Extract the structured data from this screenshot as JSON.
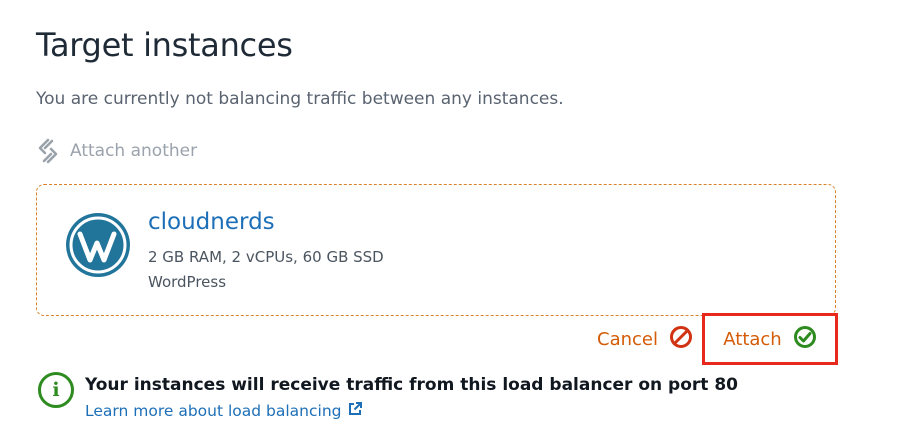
{
  "page": {
    "title": "Target instances",
    "subtitle": "You are currently not balancing traffic between any instances."
  },
  "attach_another": {
    "label": "Attach another",
    "icon": "attach-chain-icon",
    "disabled": true
  },
  "instance_card": {
    "name": "cloudnerds",
    "specs": "2 GB RAM, 2 vCPUs, 60 GB SSD",
    "blueprint": "WordPress",
    "logo_icon": "wordpress-logo-icon",
    "border_color": "#d9822b"
  },
  "actions": {
    "cancel_label": "Cancel",
    "cancel_icon": "cancel-slash-icon",
    "attach_label": "Attach",
    "attach_icon": "check-circle-icon",
    "highlight_color": "#e8281b"
  },
  "info": {
    "message": "Your instances will receive traffic from this load balancer on port 80",
    "link_label": "Learn more about load balancing",
    "icon": "info-circle-icon",
    "link_icon": "external-link-icon"
  },
  "colors": {
    "link_blue": "#1d6fb8",
    "action_orange": "#d45b07",
    "success_green": "#2e8b1f",
    "cancel_red": "#d13212"
  }
}
